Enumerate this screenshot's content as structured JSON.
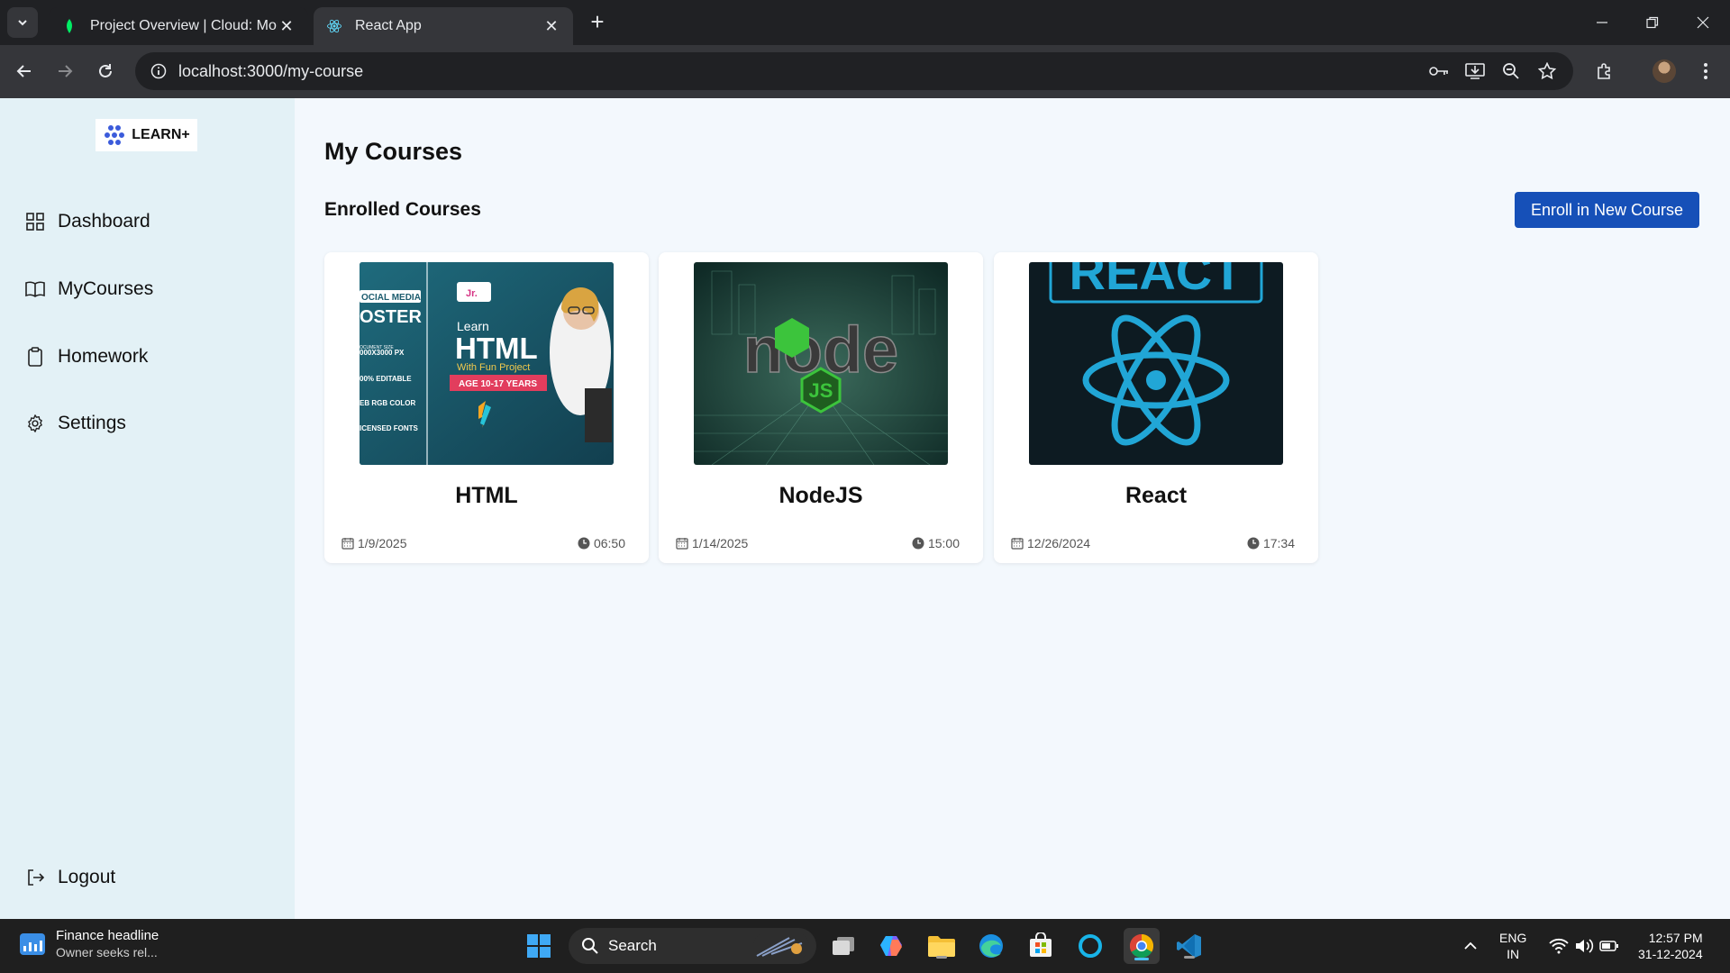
{
  "browser": {
    "tabs": [
      {
        "title": "Project Overview | Cloud: Mong",
        "active": false
      },
      {
        "title": "React App",
        "active": true
      }
    ],
    "url": "localhost:3000/my-course"
  },
  "sidebar": {
    "logo_text": "LEARN+",
    "items": [
      {
        "label": "Dashboard",
        "icon": "grid-icon"
      },
      {
        "label": "MyCourses",
        "icon": "book-icon"
      },
      {
        "label": "Homework",
        "icon": "clipboard-icon"
      },
      {
        "label": "Settings",
        "icon": "gear-icon"
      }
    ],
    "logout_label": "Logout"
  },
  "main": {
    "page_title": "My Courses",
    "section_title": "Enrolled Courses",
    "enroll_button": "Enroll in New Course",
    "courses": [
      {
        "title": "HTML",
        "date": "1/9/2025",
        "duration": "06:50",
        "thumb": {
          "left_lines": [
            "OCIAL MEDIA",
            "OSTER",
            "OCUMENT SIZE",
            "000X3000 PX",
            "00% EDITABLE",
            "EB RGB COLOR",
            "ICENSED FONTS"
          ],
          "badge": "Jr.",
          "learn": "Learn",
          "big": "HTML",
          "sub": "With Fun Project",
          "age": "AGE 10-17 YEARS"
        }
      },
      {
        "title": "NodeJS",
        "date": "1/14/2025",
        "duration": "15:00",
        "thumb": {
          "word": "node",
          "badge": "JS"
        }
      },
      {
        "title": "React",
        "date": "12/26/2024",
        "duration": "17:34",
        "thumb": {
          "banner": "REACT"
        }
      }
    ]
  },
  "taskbar": {
    "widget_title": "Finance headline",
    "widget_sub": "Owner seeks rel...",
    "search": "Search",
    "lang_1": "ENG",
    "lang_2": "IN",
    "time": "12:57 PM",
    "date": "31-12-2024"
  },
  "colors": {
    "sidebar_bg": "#e3f1f6",
    "main_bg": "#f3f8fd",
    "accent": "#1650b8"
  }
}
